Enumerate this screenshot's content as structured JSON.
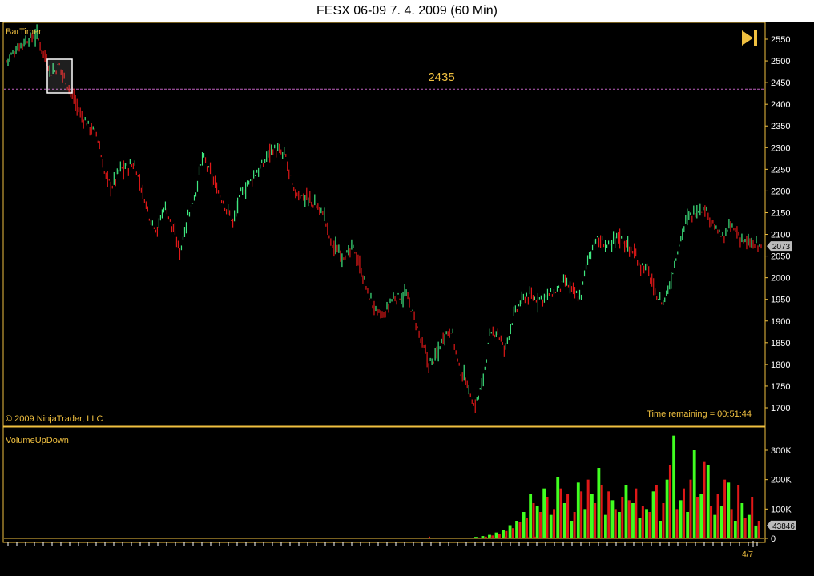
{
  "window": {
    "title": "FESX 06-09  7. 4. 2009 (60 Min)"
  },
  "colors": {
    "up": "#3fe880",
    "down": "#e01818",
    "axis": "#f0c040",
    "text": "#f0c040",
    "line": "#c060c0",
    "volUp": "#40ff20",
    "volDown": "#e01818"
  },
  "price_panel": {
    "indicator_label": "BarTimer",
    "copyright": "© 2009 NinjaTrader, LLC",
    "time_remaining": "Time remaining = 00:51:44",
    "level_label": "2435",
    "last_price_badge": "2073",
    "play_icon": "skip-to-end-icon"
  },
  "volume_panel": {
    "indicator_label": "VolumeUpDown",
    "last_volume_badge": "43846"
  },
  "x_axis": {
    "date_label": "4/7"
  },
  "chart_data": [
    {
      "type": "line",
      "title": "FESX 06-09  7. 4. 2009 (60 Min)",
      "ylim": [
        1680,
        2580
      ],
      "y_ticks": [
        2550,
        2500,
        2450,
        2400,
        2350,
        2300,
        2250,
        2200,
        2150,
        2100,
        2050,
        2000,
        1950,
        1900,
        1850,
        1800,
        1750,
        1700
      ],
      "horizontal_line": 2435,
      "last_value": 2073,
      "series": [
        {
          "x": [
            0.0,
            0.02,
            0.04,
            0.06,
            0.07,
            0.09,
            0.1,
            0.12,
            0.13,
            0.14,
            0.15,
            0.17,
            0.19,
            0.2,
            0.21,
            0.23,
            0.24,
            0.25,
            0.26,
            0.27,
            0.28,
            0.3,
            0.31,
            0.33,
            0.34,
            0.35,
            0.36,
            0.37,
            0.38,
            0.39,
            0.4,
            0.42,
            0.43,
            0.44,
            0.45,
            0.46,
            0.48,
            0.49,
            0.5,
            0.51,
            0.53,
            0.54,
            0.55,
            0.56,
            0.57,
            0.58,
            0.59,
            0.6,
            0.61,
            0.62,
            0.63,
            0.64,
            0.65,
            0.66,
            0.67,
            0.68,
            0.69,
            0.7,
            0.72,
            0.73,
            0.74,
            0.76,
            0.77,
            0.78,
            0.8,
            0.81,
            0.82,
            0.83,
            0.84,
            0.85,
            0.86,
            0.87,
            0.88,
            0.89,
            0.9,
            0.91,
            0.92,
            0.93,
            0.94,
            0.95,
            0.96,
            0.97,
            0.98,
            0.99,
            1.0
          ],
          "values": [
            2500,
            2540,
            2560,
            2470,
            2490,
            2410,
            2370,
            2330,
            2240,
            2210,
            2250,
            2260,
            2140,
            2110,
            2170,
            2060,
            2140,
            2190,
            2280,
            2240,
            2200,
            2130,
            2190,
            2240,
            2260,
            2300,
            2290,
            2280,
            2200,
            2190,
            2180,
            2150,
            2080,
            2060,
            2050,
            2070,
            1960,
            1920,
            1910,
            1950,
            1960,
            1910,
            1850,
            1800,
            1820,
            1870,
            1880,
            1790,
            1760,
            1700,
            1750,
            1860,
            1880,
            1830,
            1900,
            1940,
            1960,
            1950,
            1960,
            1970,
            1990,
            1950,
            2040,
            2090,
            2070,
            2100,
            2080,
            2060,
            2030,
            2020,
            1960,
            1940,
            1990,
            2070,
            2130,
            2150,
            2160,
            2150,
            2110,
            2090,
            2120,
            2100,
            2080,
            2075,
            2073
          ]
        }
      ]
    },
    {
      "type": "bar",
      "title": "VolumeUpDown",
      "ylim": [
        0,
        360000
      ],
      "y_ticks": [
        300000,
        200000,
        100000,
        0
      ],
      "y_tick_labels": [
        "300K",
        "200K",
        "100K",
        "0"
      ],
      "last_value": 43846,
      "x_start": 0.72,
      "up_values": [
        5000,
        8000,
        12000,
        20000,
        30000,
        45000,
        60000,
        90000,
        150000,
        110000,
        170000,
        80000,
        210000,
        120000,
        60000,
        190000,
        100000,
        150000,
        240000,
        80000,
        130000,
        90000,
        180000,
        120000,
        70000,
        100000,
        160000,
        60000,
        200000,
        350000,
        130000,
        90000,
        300000,
        150000,
        250000,
        80000,
        110000,
        190000,
        60000,
        120000,
        80000,
        43846
      ],
      "down_values": [
        3000,
        6000,
        10000,
        15000,
        25000,
        35000,
        55000,
        70000,
        120000,
        90000,
        140000,
        100000,
        170000,
        150000,
        90000,
        160000,
        200000,
        120000,
        180000,
        160000,
        100000,
        140000,
        130000,
        170000,
        110000,
        90000,
        180000,
        120000,
        250000,
        100000,
        170000,
        200000,
        140000,
        260000,
        110000,
        150000,
        200000,
        100000,
        180000,
        70000,
        140000,
        60000
      ]
    }
  ]
}
